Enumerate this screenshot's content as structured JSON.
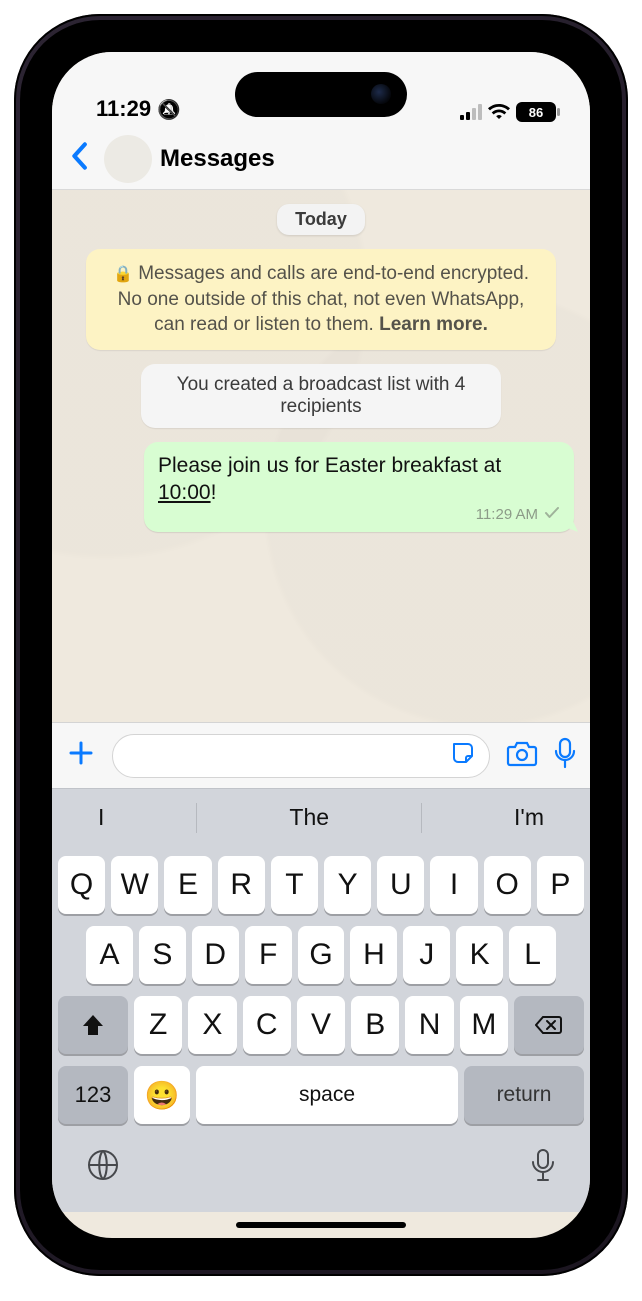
{
  "status": {
    "time": "11:29",
    "battery": "86"
  },
  "nav": {
    "title": "Messages"
  },
  "chat": {
    "date": "Today",
    "encryption_pre": "Messages and calls are end-to-end encrypted. No one outside of this chat, not even WhatsApp, can read or listen to them.",
    "encryption_learn": "Learn more.",
    "system_msg": "You created a broadcast list with 4 recipients",
    "message": {
      "text_before": "Please join us for Easter breakfast at ",
      "time_link": "10:00",
      "text_after": "!",
      "timestamp": "11:29 AM"
    }
  },
  "compose": {
    "placeholder": ""
  },
  "keyboard": {
    "suggestions": [
      "I",
      "The",
      "I'm"
    ],
    "rows": [
      [
        "Q",
        "W",
        "E",
        "R",
        "T",
        "Y",
        "U",
        "I",
        "O",
        "P"
      ],
      [
        "A",
        "S",
        "D",
        "F",
        "G",
        "H",
        "J",
        "K",
        "L"
      ],
      [
        "Z",
        "X",
        "C",
        "V",
        "B",
        "N",
        "M"
      ]
    ],
    "num_key": "123",
    "space": "space",
    "return": "return"
  }
}
